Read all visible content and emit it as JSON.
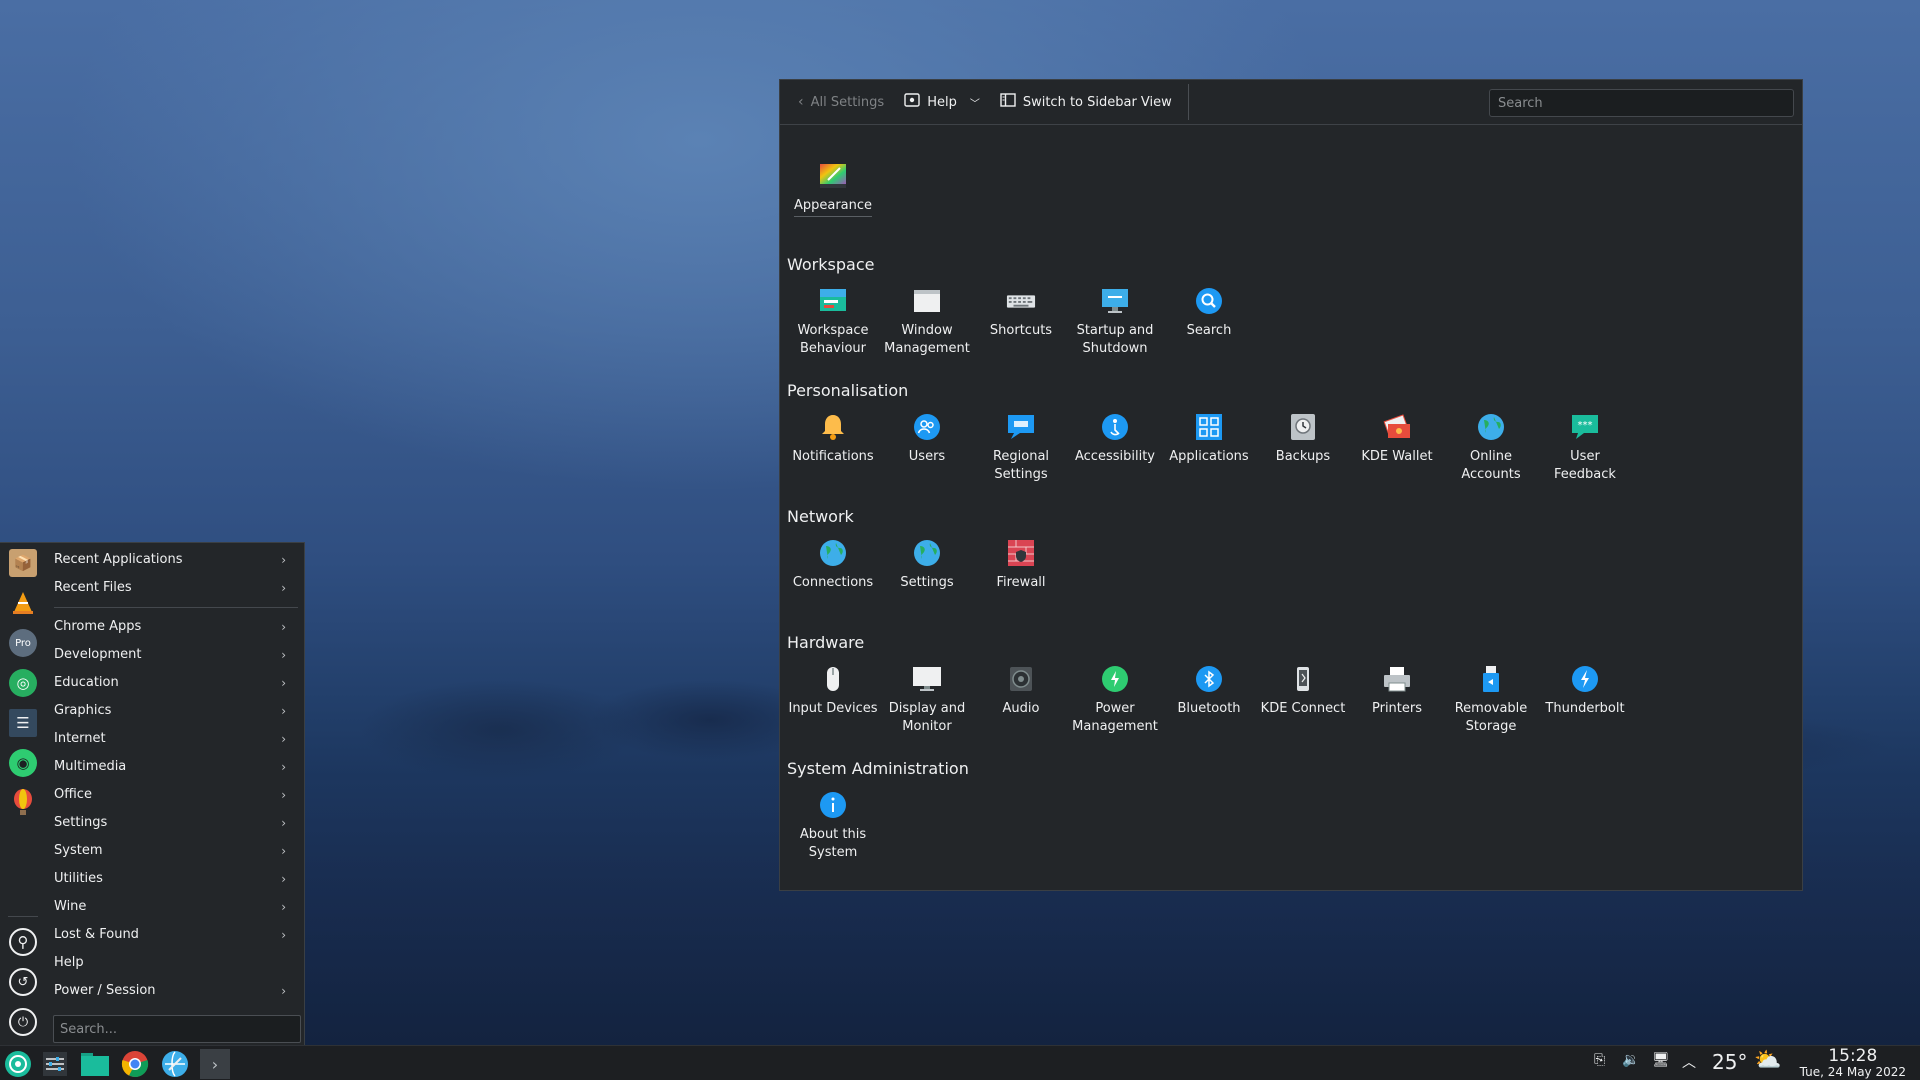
{
  "settings": {
    "toolbar": {
      "back_label": "All Settings",
      "help_label": "Help",
      "switch_label": "Switch to Sidebar View",
      "search_placeholder": "Search"
    },
    "top_item": {
      "label": "Appearance",
      "icon": "appearance-icon"
    },
    "categories": [
      {
        "title": "Workspace",
        "items": [
          {
            "label": "Workspace Behaviour",
            "icon": "workspace-behaviour-icon",
            "color": "#3daee9"
          },
          {
            "label": "Window Management",
            "icon": "window-management-icon",
            "color": "#eff0f1"
          },
          {
            "label": "Shortcuts",
            "icon": "keyboard-icon",
            "color": "#bdc3c7"
          },
          {
            "label": "Startup and Shutdown",
            "icon": "monitor-icon",
            "color": "#3daee9"
          },
          {
            "label": "Search",
            "icon": "search-icon",
            "color": "#1d99f3"
          }
        ]
      },
      {
        "title": "Personalisation",
        "items": [
          {
            "label": "Notifications",
            "icon": "bell-icon",
            "color": "#fdbc4b"
          },
          {
            "label": "Users",
            "icon": "users-icon",
            "color": "#1d99f3"
          },
          {
            "label": "Regional Settings",
            "icon": "regional-icon",
            "color": "#1d99f3"
          },
          {
            "label": "Accessibility",
            "icon": "accessibility-icon",
            "color": "#1d99f3"
          },
          {
            "label": "Applications",
            "icon": "applications-icon",
            "color": "#1d99f3"
          },
          {
            "label": "Backups",
            "icon": "backups-icon",
            "color": "#bdc3c7"
          },
          {
            "label": "KDE Wallet",
            "icon": "wallet-icon",
            "color": "#e74c3c"
          },
          {
            "label": "Online Accounts",
            "icon": "globe-icon",
            "color": "#27ae60"
          },
          {
            "label": "User Feedback",
            "icon": "feedback-icon",
            "color": "#1abc9c"
          }
        ]
      },
      {
        "title": "Network",
        "items": [
          {
            "label": "Connections",
            "icon": "globe-icon",
            "color": "#27ae60"
          },
          {
            "label": "Settings",
            "icon": "globe-icon",
            "color": "#27ae60"
          },
          {
            "label": "Firewall",
            "icon": "firewall-icon",
            "color": "#da4453"
          }
        ]
      },
      {
        "title": "Hardware",
        "items": [
          {
            "label": "Input Devices",
            "icon": "mouse-icon",
            "color": "#eff0f1"
          },
          {
            "label": "Display and Monitor",
            "icon": "display-icon",
            "color": "#eff0f1"
          },
          {
            "label": "Audio",
            "icon": "speaker-icon",
            "color": "#7f8c8d"
          },
          {
            "label": "Power Management",
            "icon": "power-icon",
            "color": "#2ecc71"
          },
          {
            "label": "Bluetooth",
            "icon": "bluetooth-icon",
            "color": "#1d99f3"
          },
          {
            "label": "KDE Connect",
            "icon": "phone-icon",
            "color": "#bdc3c7"
          },
          {
            "label": "Printers",
            "icon": "printer-icon",
            "color": "#bdc3c7"
          },
          {
            "label": "Removable Storage",
            "icon": "usb-icon",
            "color": "#1d99f3"
          },
          {
            "label": "Thunderbolt",
            "icon": "thunderbolt-icon",
            "color": "#1d99f3"
          }
        ]
      },
      {
        "title": "System Administration",
        "items": [
          {
            "label": "About this System",
            "icon": "info-icon",
            "color": "#1d99f3"
          }
        ]
      }
    ]
  },
  "launcher": {
    "items": [
      {
        "label": "Recent Applications",
        "arrow": true
      },
      {
        "label": "Recent Files",
        "arrow": true
      },
      {
        "label": "Chrome Apps",
        "arrow": true
      },
      {
        "label": "Development",
        "arrow": true
      },
      {
        "label": "Education",
        "arrow": true
      },
      {
        "label": "Graphics",
        "arrow": true
      },
      {
        "label": "Internet",
        "arrow": true
      },
      {
        "label": "Multimedia",
        "arrow": true
      },
      {
        "label": "Office",
        "arrow": true
      },
      {
        "label": "Settings",
        "arrow": true
      },
      {
        "label": "System",
        "arrow": true
      },
      {
        "label": "Utilities",
        "arrow": true
      },
      {
        "label": "Wine",
        "arrow": true
      },
      {
        "label": "Lost & Found",
        "arrow": true
      },
      {
        "label": "Help",
        "arrow": false
      },
      {
        "label": "Power / Session",
        "arrow": true
      }
    ],
    "search_placeholder": "Search..."
  },
  "taskbar": {
    "temperature": "25°",
    "time": "15:28",
    "date": "Tue, 24 May 2022"
  }
}
